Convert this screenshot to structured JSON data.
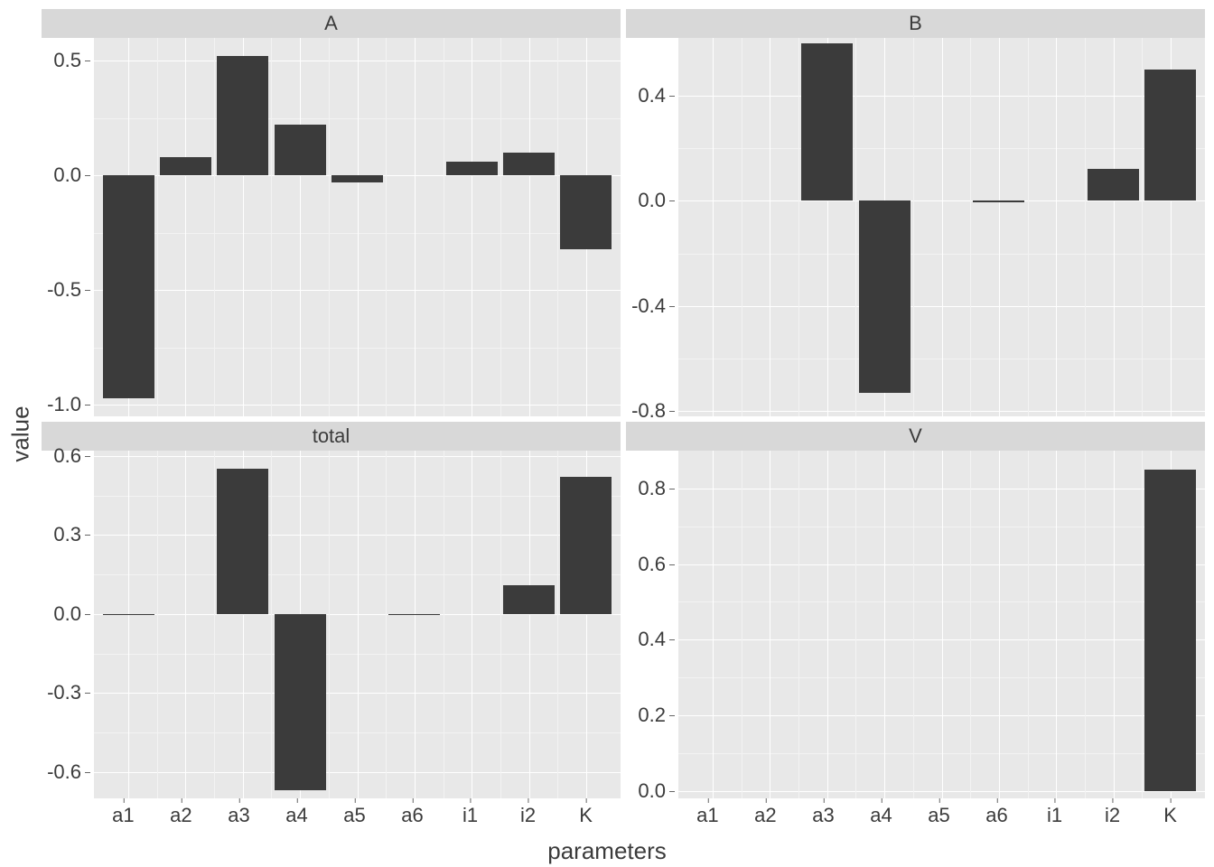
{
  "axis_labels": {
    "x": "parameters",
    "y": "value"
  },
  "bar_fill": "#3b3b3b",
  "facets": [
    "A",
    "B",
    "total",
    "V"
  ],
  "categories": [
    "a1",
    "a2",
    "a3",
    "a4",
    "a5",
    "a6",
    "i1",
    "i2",
    "K"
  ],
  "chart_data": [
    {
      "type": "bar",
      "facet": "A",
      "categories": [
        "a1",
        "a2",
        "a3",
        "a4",
        "a5",
        "a6",
        "i1",
        "i2",
        "K"
      ],
      "values": [
        -0.97,
        0.08,
        0.52,
        0.22,
        -0.03,
        0.0,
        0.06,
        0.1,
        -0.32
      ],
      "ylim": [
        -1.05,
        0.6
      ],
      "yticks": [
        -1.0,
        -0.5,
        0.0,
        0.5
      ],
      "xlabel": "parameters",
      "ylabel": "value",
      "show_xticklabels": false
    },
    {
      "type": "bar",
      "facet": "B",
      "categories": [
        "a1",
        "a2",
        "a3",
        "a4",
        "a5",
        "a6",
        "i1",
        "i2",
        "K"
      ],
      "values": [
        0.0,
        0.0,
        0.6,
        -0.73,
        0.0,
        -0.005,
        0.0,
        0.12,
        0.5
      ],
      "ylim": [
        -0.82,
        0.62
      ],
      "yticks": [
        -0.8,
        -0.4,
        0.0,
        0.4
      ],
      "xlabel": "parameters",
      "ylabel": "value",
      "show_xticklabels": false
    },
    {
      "type": "bar",
      "facet": "total",
      "categories": [
        "a1",
        "a2",
        "a3",
        "a4",
        "a5",
        "a6",
        "i1",
        "i2",
        "K"
      ],
      "values": [
        -0.005,
        0.0,
        0.55,
        -0.67,
        0.0,
        -0.005,
        0.0,
        0.11,
        0.52
      ],
      "ylim": [
        -0.7,
        0.62
      ],
      "yticks": [
        -0.6,
        -0.3,
        0.0,
        0.3,
        0.6
      ],
      "xlabel": "parameters",
      "ylabel": "value",
      "show_xticklabels": true
    },
    {
      "type": "bar",
      "facet": "V",
      "categories": [
        "a1",
        "a2",
        "a3",
        "a4",
        "a5",
        "a6",
        "i1",
        "i2",
        "K"
      ],
      "values": [
        0.0,
        0.0,
        0.0,
        0.0,
        0.0,
        0.0,
        0.0,
        0.0,
        0.85
      ],
      "ylim": [
        -0.02,
        0.9
      ],
      "yticks": [
        0.0,
        0.2,
        0.4,
        0.6,
        0.8
      ],
      "xlabel": "parameters",
      "ylabel": "value",
      "show_xticklabels": true
    }
  ]
}
